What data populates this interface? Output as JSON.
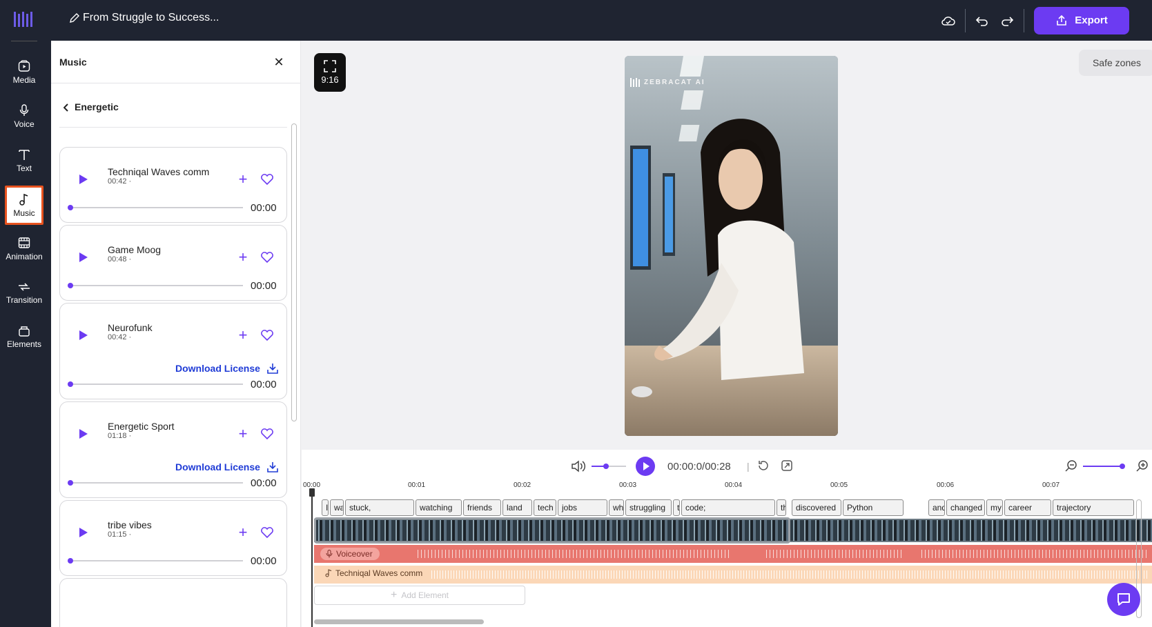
{
  "header": {
    "project_title": "From Struggle to Success...",
    "export_label": "Export"
  },
  "nav": {
    "items": [
      {
        "label": "Media",
        "icon": "media-icon"
      },
      {
        "label": "Voice",
        "icon": "microphone-icon"
      },
      {
        "label": "Text",
        "icon": "text-icon"
      },
      {
        "label": "Music",
        "icon": "music-note-icon",
        "active": true
      },
      {
        "label": "Animation",
        "icon": "film-icon"
      },
      {
        "label": "Transition",
        "icon": "transition-icon"
      },
      {
        "label": "Elements",
        "icon": "elements-icon"
      }
    ]
  },
  "panel": {
    "title": "Music",
    "category": "Energetic",
    "download_label": "Download License",
    "tracks": [
      {
        "name": "Techniqal Waves comm",
        "duration": "00:42 ·",
        "time": "00:00"
      },
      {
        "name": "Game Moog",
        "duration": "00:48 ·",
        "time": "00:00"
      },
      {
        "name": "Neurofunk",
        "duration": "00:42 ·",
        "time": "00:00"
      },
      {
        "name": "Energetic Sport",
        "duration": "01:18 ·",
        "time": "00:00"
      },
      {
        "name": "tribe vibes",
        "duration": "01:15 ·",
        "time": "00:00"
      }
    ]
  },
  "canvas": {
    "aspect_ratio": "9:16",
    "safe_zones_label": "Safe zones",
    "watermark": "ZEBRACAT AI"
  },
  "timeline": {
    "timecode": "00:00:0/00:28",
    "ticks": [
      "00:00",
      "00:01",
      "00:02",
      "00:03",
      "00:04",
      "00:05",
      "00:06",
      "00:07"
    ],
    "words": [
      "I",
      "wa",
      "stuck,",
      "watching",
      "friends",
      "land",
      "tech",
      "jobs",
      "wh",
      "struggling",
      "t",
      "code;",
      "th",
      "discovered",
      "Python",
      "and",
      "changed",
      "my",
      "career",
      "trajectory"
    ],
    "voiceover_label": "Voiceover",
    "music_label": "Techniqal Waves comm",
    "add_element_label": "Add Element"
  },
  "colors": {
    "accent": "#6c3bf2",
    "chrome": "#1f2431",
    "voiceover": "#e8766e",
    "music": "#fbd7b7",
    "active_outline": "#e8531f"
  }
}
